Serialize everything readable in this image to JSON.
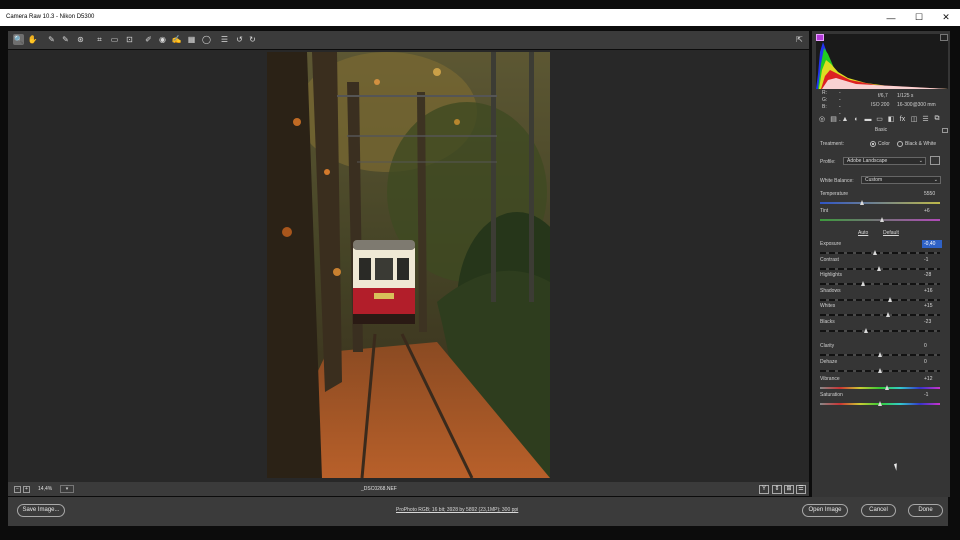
{
  "window": {
    "title": "Camera Raw 10.3  -  Nikon D5300",
    "minimize": "—",
    "maximize": "☐",
    "close": "✕"
  },
  "toolbar": {
    "tools": [
      {
        "icon": "zoom-icon",
        "glyph": "🔍",
        "active": true
      },
      {
        "icon": "hand-icon",
        "glyph": "✋"
      },
      {
        "icon": "white-balance-icon",
        "glyph": "✎"
      },
      {
        "icon": "color-sampler-icon",
        "glyph": "✎"
      },
      {
        "icon": "targeted-adjust-icon",
        "glyph": "⊛"
      },
      {
        "icon": "crop-icon",
        "glyph": "⌗"
      },
      {
        "icon": "straighten-icon",
        "glyph": "▭"
      },
      {
        "icon": "transform-icon",
        "glyph": "⊡"
      },
      {
        "icon": "spot-removal-icon",
        "glyph": "✐"
      },
      {
        "icon": "red-eye-icon",
        "glyph": "◉"
      },
      {
        "icon": "adjustment-brush-icon",
        "glyph": "✍"
      },
      {
        "icon": "graduated-filter-icon",
        "glyph": "▦"
      },
      {
        "icon": "radial-filter-icon",
        "glyph": "◯"
      },
      {
        "icon": "preferences-icon",
        "glyph": "☰"
      },
      {
        "icon": "rotate-left-icon",
        "glyph": "↺"
      },
      {
        "icon": "rotate-right-icon",
        "glyph": "↻"
      }
    ],
    "fullscreen_glyph": "⇱"
  },
  "status": {
    "zoom": "14,4%",
    "zoom_arrow": "▾",
    "filename": "_DSC0268.NEF",
    "zoom_out": "−",
    "zoom_in": "+",
    "view_labels": [
      "Y",
      "⇕",
      "⊞",
      "☰"
    ]
  },
  "bottom": {
    "save_label": "Save Image...",
    "workflow": "ProPhoto RGB; 16 bit; 3928 by 5892 (23,1MP); 300 ppi",
    "open_label": "Open Image",
    "cancel_label": "Cancel",
    "done_label": "Done"
  },
  "histogram": {
    "r_label": "R:",
    "g_label": "G:",
    "b_label": "B:",
    "r_value": "---",
    "g_value": "---",
    "b_value": "---",
    "aperture": "f/6,7",
    "shutter": "1/125 s",
    "iso": "ISO 200",
    "lens": "16-300@300 mm"
  },
  "panel_tabs": [
    "◎",
    "▤",
    "▲",
    "◐",
    "▬",
    "▭",
    "◧",
    "fx",
    "◫",
    "☰",
    "⧉"
  ],
  "basic": {
    "section_title": "Basic",
    "treatment_label": "Treatment:",
    "treatment_color": "Color",
    "treatment_bw": "Black & White",
    "treatment_selected": "Color",
    "profile_label": "Profile:",
    "profile_value": "Adobe Landscape",
    "wb_label": "White Balance:",
    "wb_value": "Custom",
    "auto_label": "Auto",
    "default_label": "Default",
    "sliders": [
      {
        "name": "Temperature",
        "value": "5550",
        "pos": 0.35,
        "type": "temp"
      },
      {
        "name": "Tint",
        "value": "+6",
        "pos": 0.52,
        "type": "tint"
      },
      {
        "name": "Exposure",
        "value": "-0,40",
        "pos": 0.46,
        "type": "dash",
        "highlight": true
      },
      {
        "name": "Contrast",
        "value": "-1",
        "pos": 0.49,
        "type": "dash"
      },
      {
        "name": "Highlights",
        "value": "-28",
        "pos": 0.36,
        "type": "dash"
      },
      {
        "name": "Shadows",
        "value": "+16",
        "pos": 0.58,
        "type": "dash"
      },
      {
        "name": "Whites",
        "value": "+15",
        "pos": 0.57,
        "type": "dash"
      },
      {
        "name": "Blacks",
        "value": "-23",
        "pos": 0.38,
        "type": "dash"
      },
      {
        "name": "Clarity",
        "value": "0",
        "pos": 0.5,
        "type": "dash"
      },
      {
        "name": "Dehaze",
        "value": "0",
        "pos": 0.5,
        "type": "dash"
      },
      {
        "name": "Vibrance",
        "value": "+12",
        "pos": 0.56,
        "type": "sat"
      },
      {
        "name": "Saturation",
        "value": "-1",
        "pos": 0.5,
        "type": "sat"
      }
    ]
  }
}
